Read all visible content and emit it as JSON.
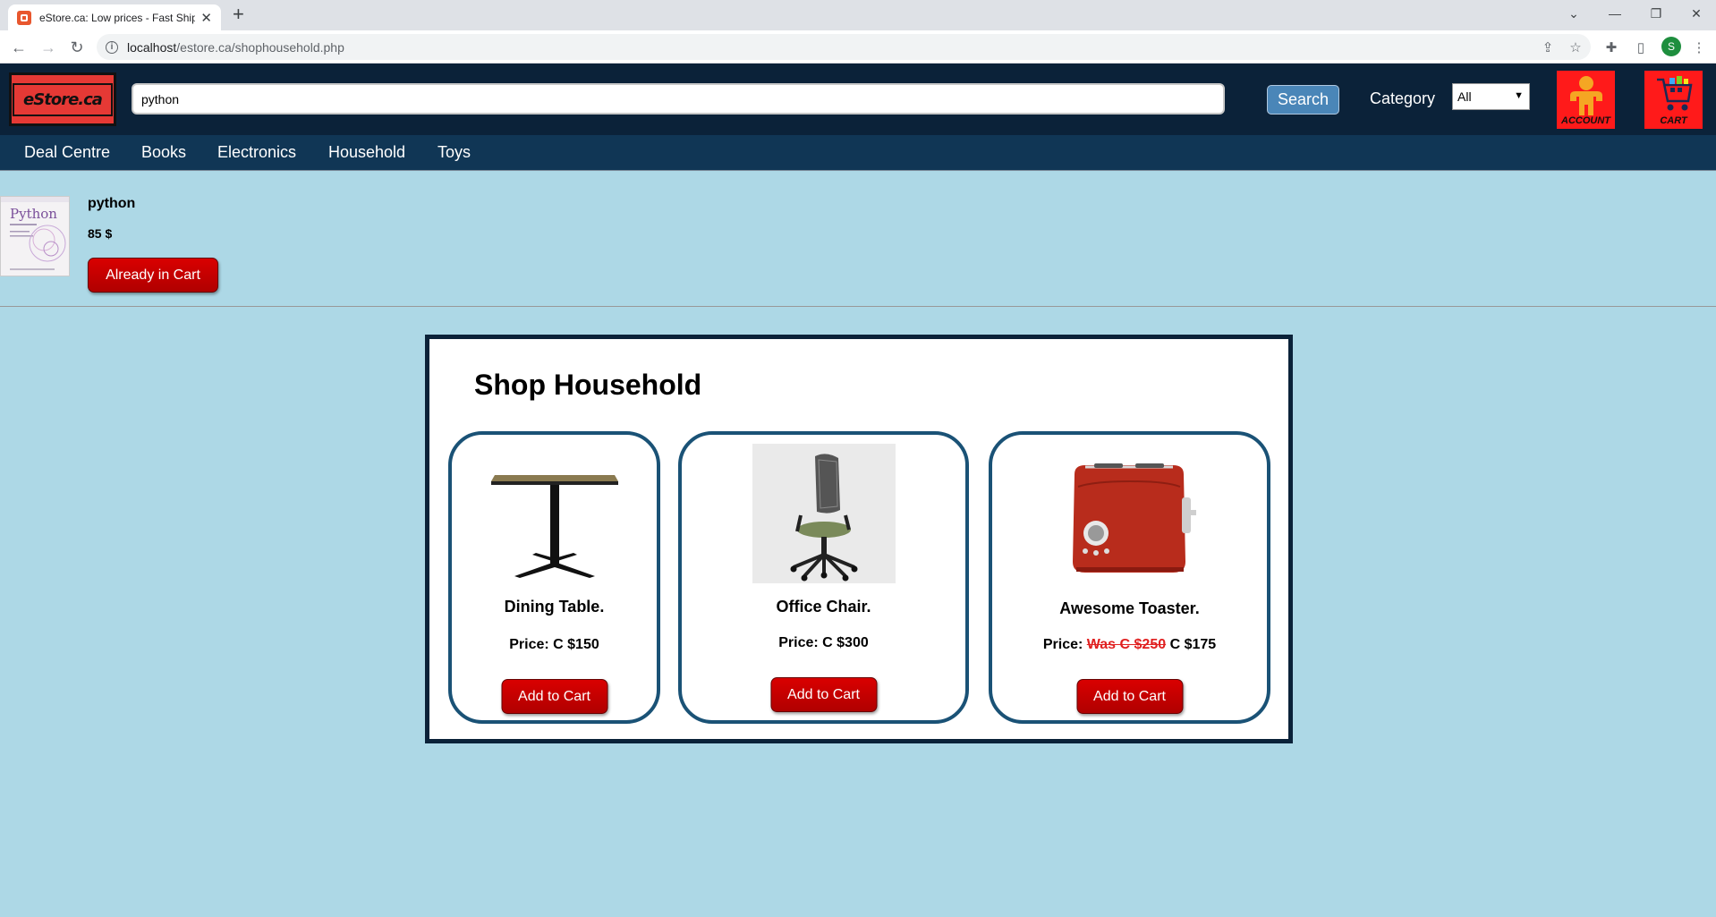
{
  "browser": {
    "tab_title": "eStore.ca: Low prices - Fast Shipp",
    "url_host": "localhost",
    "url_path": "/estore.ca/shophousehold.php",
    "profile_initial": "S"
  },
  "header": {
    "logo_text": "eStore.ca",
    "search_value": "python",
    "search_button": "Search",
    "category_label": "Category",
    "category_selected": "All",
    "account_label": "ACCOUNT",
    "cart_label": "CART"
  },
  "nav": [
    "Deal Centre",
    "Books",
    "Electronics",
    "Household",
    "Toys"
  ],
  "cart_item": {
    "name": "python",
    "price": "85 $",
    "button": "Already in Cart",
    "cover_title": "Python"
  },
  "shop": {
    "title": "Shop Household",
    "products": [
      {
        "name": "Dining Table.",
        "price_label": "Price:",
        "was": "",
        "price": "C $150",
        "button": "Add to Cart"
      },
      {
        "name": "Office Chair.",
        "price_label": "Price:",
        "was": "",
        "price": "C $300",
        "button": "Add to Cart"
      },
      {
        "name": "Awesome Toaster.",
        "price_label": "Price:",
        "was": "Was C $250",
        "price": "C $175",
        "button": "Add to Cart"
      }
    ]
  },
  "colors": {
    "page_bg": "#add8e6",
    "header_bg": "#0b2239",
    "nav_bg": "#103655",
    "button_red": "#c00000",
    "card_border": "#1a5276"
  }
}
